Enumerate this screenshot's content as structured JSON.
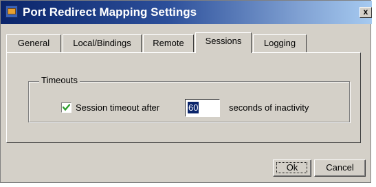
{
  "window": {
    "title": "Port Redirect Mapping Settings",
    "close_label": "x"
  },
  "tabs": [
    {
      "label": "General",
      "active": false
    },
    {
      "label": "Local/Bindings",
      "active": false
    },
    {
      "label": "Remote",
      "active": false
    },
    {
      "label": "Sessions",
      "active": true
    },
    {
      "label": "Logging",
      "active": false
    }
  ],
  "timeouts": {
    "group_label": "Timeouts",
    "checkbox_checked": true,
    "checkbox_label": "Session timeout after",
    "timeout_value": "60",
    "suffix_label": "seconds of inactivity"
  },
  "buttons": {
    "ok_label": "Ok",
    "cancel_label": "Cancel"
  },
  "colors": {
    "title_bar": "#0a246a",
    "checkmark": "#2e9e2e",
    "dialog_face": "#d4d0c8"
  }
}
